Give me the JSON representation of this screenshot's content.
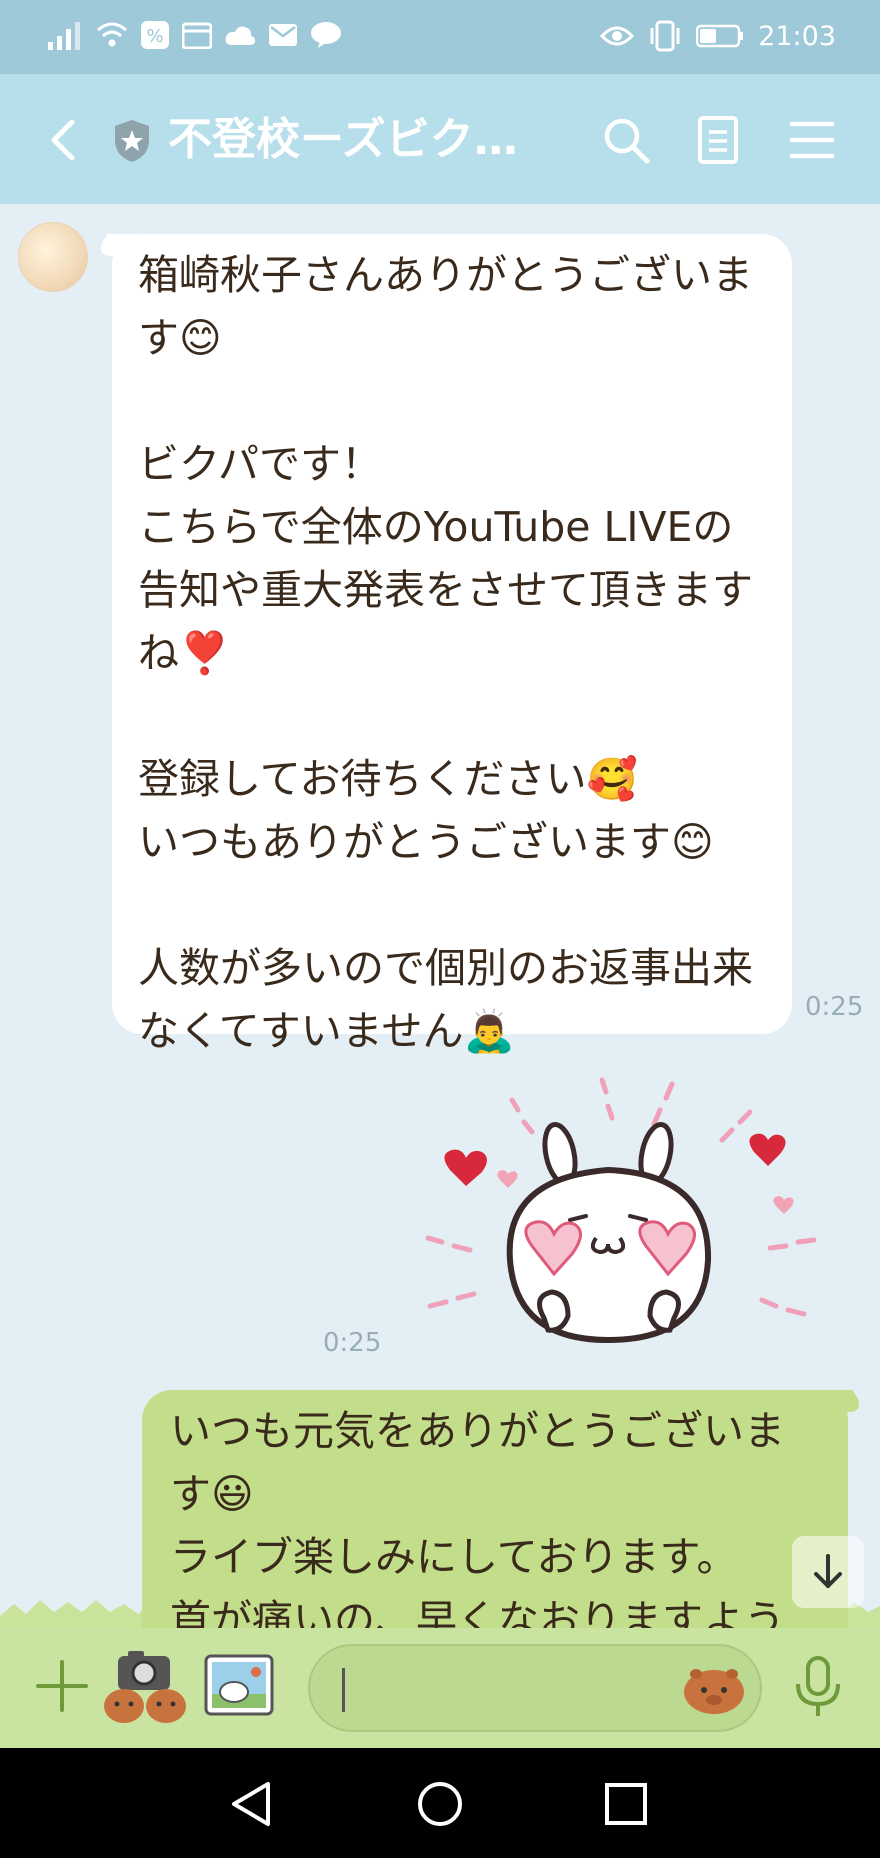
{
  "status_bar": {
    "time": "21:03"
  },
  "header": {
    "title": "不登校ーズビク…",
    "back_icon": "chevron-left-icon",
    "search_icon": "search-icon",
    "notes_icon": "notes-icon",
    "menu_icon": "menu-icon"
  },
  "messages": {
    "incoming": {
      "text": "箱崎秋子さんありがとうございます😊\n\nビクパです！\nこちらで全体のYouTube LIVEの告知や重大発表をさせて頂きますね❣️\n\n登録してお待ちください🥰\nいつもありがとうございます😊\n\n人数が多いので個別のお返事出来なくてすいません🙇‍♂️",
      "time": "0:25"
    },
    "sticker": {
      "time": "0:25"
    },
    "outgoing": {
      "text": "いつも元気をありがとうございます😃\nライブ楽しみにしております。\n首が痛いの、早くなおりますよう"
    }
  },
  "colors": {
    "status_bar": "#9dc9d8",
    "header": "#b6dfeb",
    "chat_bg": "#e4eef5",
    "incoming_bubble": "#ffffff",
    "outgoing_bubble": "#c3de8b",
    "input_bar": "#c9e4a0",
    "nav_bar": "#000000"
  }
}
